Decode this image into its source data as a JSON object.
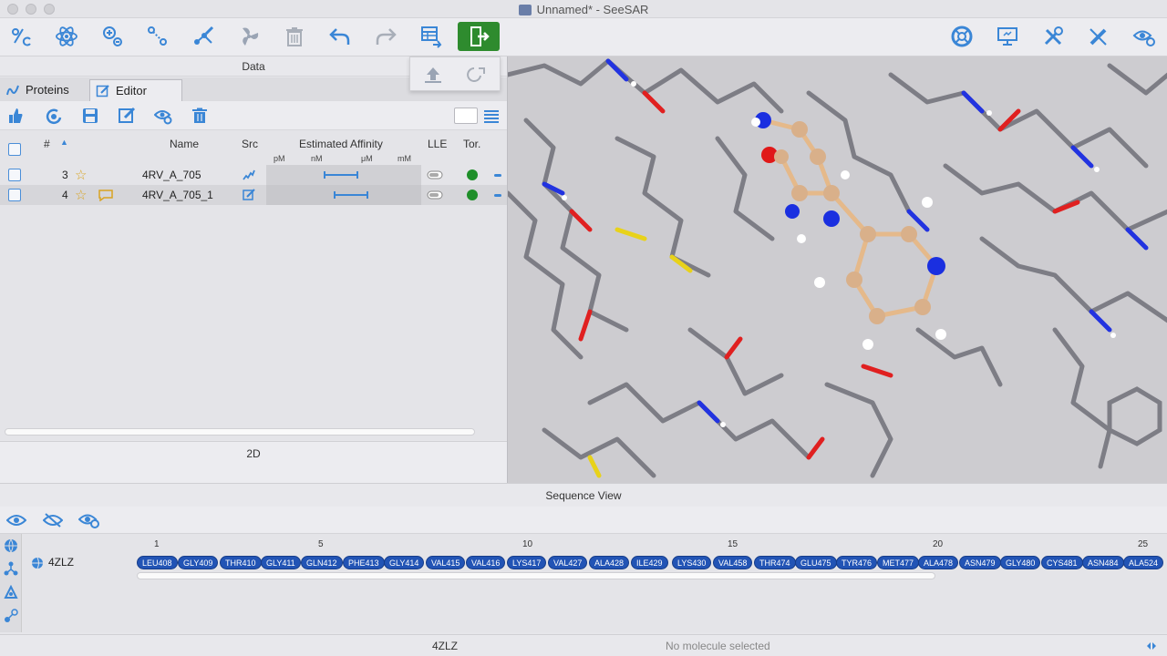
{
  "window": {
    "title": "Unnamed* - SeeSAR"
  },
  "panels": {
    "data_header": "Data",
    "two_d_header": "2D",
    "sequence_header": "Sequence View"
  },
  "tabs": [
    {
      "label": "Proteins",
      "selected": false
    },
    {
      "label": "Editor",
      "selected": true
    }
  ],
  "table": {
    "columns": {
      "index": "#",
      "name": "Name",
      "src": "Src",
      "affinity": "Estimated Affinity",
      "lle": "LLE",
      "tor": "Tor."
    },
    "affinity_units": [
      "pM",
      "nM",
      "μM",
      "mM"
    ],
    "rows": [
      {
        "index": "3",
        "name": "4RV_A_705"
      },
      {
        "index": "4",
        "name": "4RV_A_705_1"
      }
    ]
  },
  "sequence": {
    "chain": "4ZLZ",
    "ticks": [
      "1",
      "5",
      "10",
      "15",
      "20",
      "25"
    ],
    "residues": [
      "LEU408",
      "GLY409",
      "THR410",
      "GLY411",
      "GLN412",
      "PHE413",
      "GLY414",
      "VAL415",
      "VAL416",
      "LYS417",
      "VAL427",
      "ALA428",
      "ILE429",
      "LYS430",
      "VAL458",
      "THR474",
      "GLU475",
      "TYR476",
      "MET477",
      "ALA478",
      "ASN479",
      "GLY480",
      "CYS481",
      "ASN484",
      "ALA524"
    ]
  },
  "status": {
    "protein": "4ZLZ",
    "selection": "No molecule selected"
  },
  "colors": {
    "accent": "#3a86d6",
    "active_button": "#2e8b2e",
    "residue_pill": "#2254b5",
    "star": "#d9a423",
    "status_ok": "#1f8f2a"
  }
}
